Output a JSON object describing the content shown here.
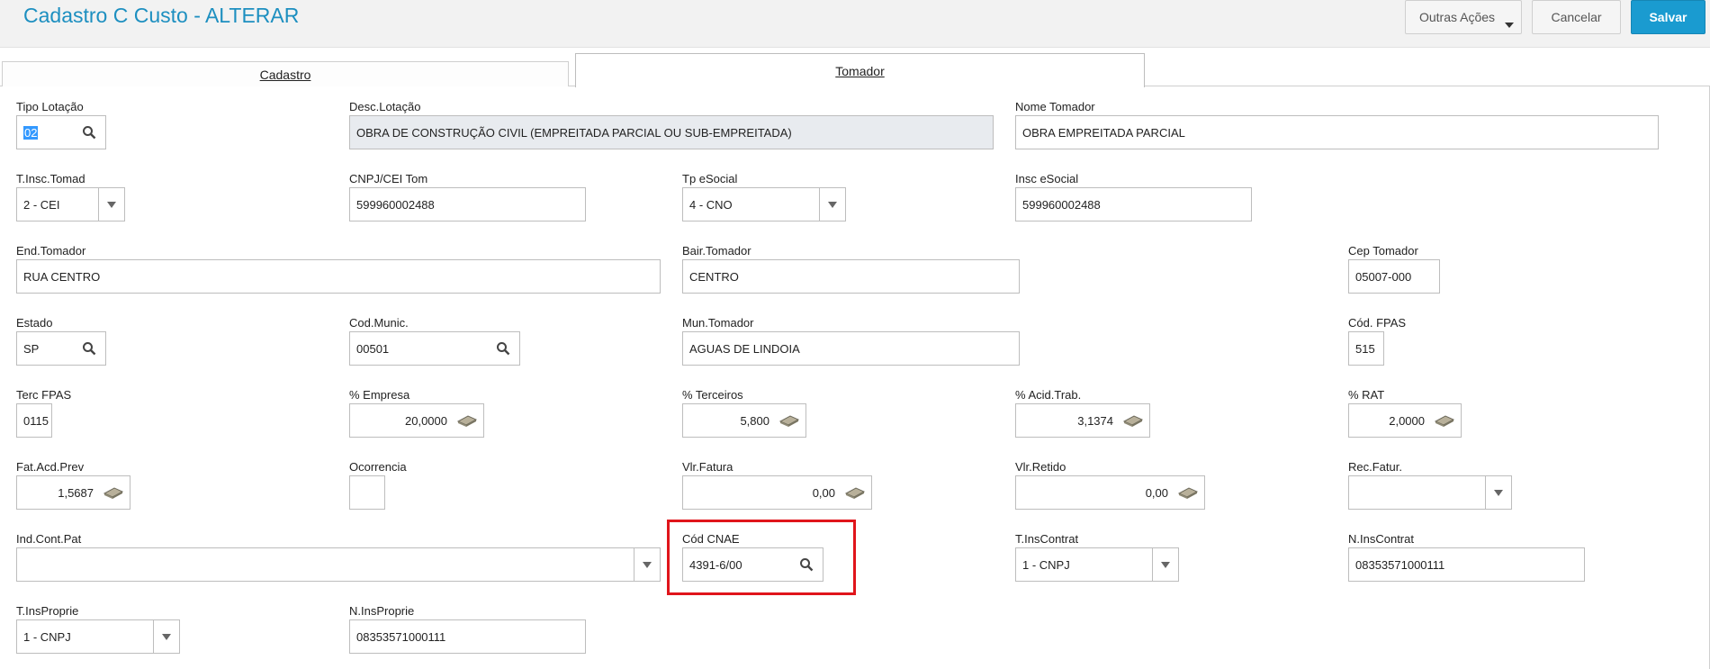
{
  "header": {
    "title": "Cadastro C Custo - ALTERAR",
    "outras_acoes": "Outras Ações",
    "cancelar": "Cancelar",
    "salvar": "Salvar"
  },
  "tabs": [
    {
      "label": "Cadastro",
      "active": false
    },
    {
      "label": "Tomador",
      "active": true
    }
  ],
  "fields": {
    "tipo_lotacao": {
      "label": "Tipo Lotação",
      "value": "02"
    },
    "desc_lotacao": {
      "label": "Desc.Lotação",
      "value": "OBRA DE CONSTRUÇÃO CIVIL (EMPREITADA PARCIAL OU SUB-EMPREITADA)"
    },
    "nome_tomador": {
      "label": "Nome Tomador",
      "value": "OBRA EMPREITADA PARCIAL"
    },
    "t_insc_tomad": {
      "label": "T.Insc.Tomad",
      "value": "2 - CEI"
    },
    "cnpj_cei_tom": {
      "label": "CNPJ/CEI Tom",
      "value": "599960002488"
    },
    "tp_esocial": {
      "label": "Tp eSocial",
      "value": "4 - CNO"
    },
    "insc_esocial": {
      "label": "Insc eSocial",
      "value": "599960002488"
    },
    "end_tomador": {
      "label": "End.Tomador",
      "value": "RUA CENTRO"
    },
    "bair_tomador": {
      "label": "Bair.Tomador",
      "value": "CENTRO"
    },
    "cep_tomador": {
      "label": "Cep Tomador",
      "value": "05007-000"
    },
    "estado": {
      "label": "Estado",
      "value": "SP"
    },
    "cod_munic": {
      "label": "Cod.Munic.",
      "value": "00501"
    },
    "mun_tomador": {
      "label": "Mun.Tomador",
      "value": "AGUAS DE LINDOIA"
    },
    "cod_fpas": {
      "label": "Cód. FPAS",
      "value": "515"
    },
    "terc_fpas": {
      "label": "Terc FPAS",
      "value": "0115"
    },
    "pct_empresa": {
      "label": "% Empresa",
      "value": "20,0000"
    },
    "pct_terceiros": {
      "label": "% Terceiros",
      "value": "5,800"
    },
    "pct_acid_trab": {
      "label": "% Acid.Trab.",
      "value": "3,1374"
    },
    "pct_rat": {
      "label": "% RAT",
      "value": "2,0000"
    },
    "fat_acd_prev": {
      "label": "Fat.Acd.Prev",
      "value": "1,5687"
    },
    "ocorrencia": {
      "label": "Ocorrencia",
      "value": ""
    },
    "vlr_fatura": {
      "label": "Vlr.Fatura",
      "value": "0,00"
    },
    "vlr_retido": {
      "label": "Vlr.Retido",
      "value": "0,00"
    },
    "rec_fatur": {
      "label": "Rec.Fatur.",
      "value": ""
    },
    "ind_cont_pat": {
      "label": "Ind.Cont.Pat",
      "value": ""
    },
    "cod_cnae": {
      "label": "Cód CNAE",
      "value": "4391-6/00"
    },
    "t_inscontrat": {
      "label": "T.InsContrat",
      "value": "1 - CNPJ"
    },
    "n_inscontrat": {
      "label": "N.InsContrat",
      "value": "08353571000111"
    },
    "t_insproprie": {
      "label": "T.InsProprie",
      "value": "1 - CNPJ"
    },
    "n_insproprie": {
      "label": "N.InsProprie",
      "value": "08353571000111"
    }
  },
  "icons": {
    "lookup": "search-icon",
    "calculator": "calculator-icon",
    "dropdown": "chevron-down-icon"
  },
  "colors": {
    "title": "#1d8fc0",
    "primary_button": "#1a9bd0",
    "highlight_box": "#e0151b",
    "readonly_field": "#e8ebef"
  }
}
